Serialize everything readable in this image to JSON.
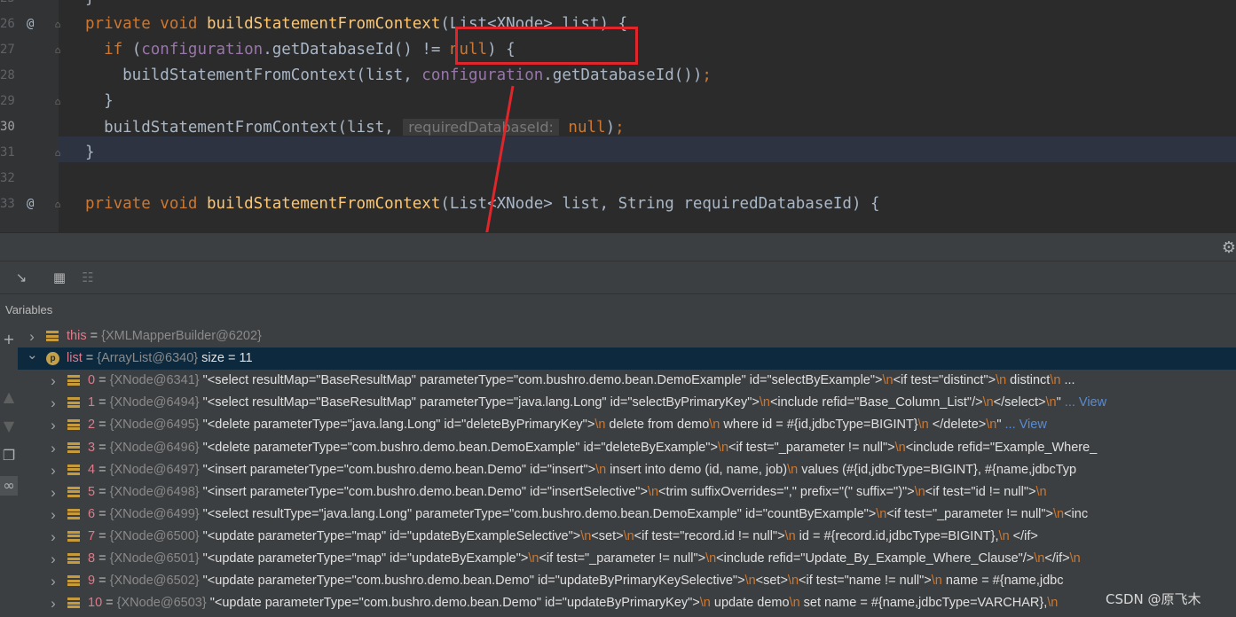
{
  "editor": {
    "lines": [
      {
        "num": "25",
        "code": [
          {
            "t": "}",
            "c": "pl"
          }
        ]
      },
      {
        "num": "26",
        "marker": "@",
        "code": [
          {
            "t": "private ",
            "c": "kw"
          },
          {
            "t": "void ",
            "c": "kw"
          },
          {
            "t": "buildStatementFromContext",
            "c": "fn"
          },
          {
            "t": "(List<XNode> list) {",
            "c": "pl"
          }
        ]
      },
      {
        "num": "27",
        "code": [
          {
            "t": "  if ",
            "c": "kw"
          },
          {
            "t": "(",
            "c": "pl"
          },
          {
            "t": "configuration",
            "c": "fld"
          },
          {
            "t": ".getDatabaseId() != ",
            "c": "pl"
          },
          {
            "t": "null",
            "c": "kw"
          },
          {
            "t": ") {",
            "c": "pl"
          }
        ]
      },
      {
        "num": "28",
        "code": [
          {
            "t": "    buildStatementFromContext(list, ",
            "c": "pl"
          },
          {
            "t": "configuration",
            "c": "fld"
          },
          {
            "t": ".getDatabaseId())",
            "c": "pl"
          },
          {
            "t": ";",
            "c": "kw"
          }
        ]
      },
      {
        "num": "29",
        "code": [
          {
            "t": "  }",
            "c": "pl"
          }
        ]
      },
      {
        "num": "30",
        "current": true,
        "code": [
          {
            "t": "  buildStatementFromContext(list, ",
            "c": "pl"
          },
          {
            "hint": "requiredDatabaseId:"
          },
          {
            "t": " null",
            "c": "kw"
          },
          {
            "t": ")",
            "c": "pl"
          },
          {
            "t": ";",
            "c": "kw"
          }
        ]
      },
      {
        "num": "31",
        "code": [
          {
            "t": "}",
            "c": "pl"
          }
        ]
      },
      {
        "num": "32",
        "code": []
      },
      {
        "num": "33",
        "marker": "@",
        "code": [
          {
            "t": "private ",
            "c": "kw"
          },
          {
            "t": "void ",
            "c": "kw"
          },
          {
            "t": "buildStatementFromContext",
            "c": "fn"
          },
          {
            "t": "(List<XNode> list, String requiredDatabaseId) {",
            "c": "pl"
          }
        ]
      }
    ]
  },
  "panel": {
    "variables_title": "Variables",
    "toolbar_icons": [
      "step-cursor-icon",
      "table-icon",
      "grid-off-icon"
    ]
  },
  "variables": [
    {
      "name": "this",
      "ref": "{XMLMapperBuilder@6202}",
      "value": "",
      "expand": "collapsed",
      "icon": "field",
      "indent": 0
    },
    {
      "name": "list",
      "ref": "{ArrayList@6340}",
      "value": "size = 11",
      "expand": "expanded",
      "icon": "p",
      "indent": 0,
      "selected": true
    },
    {
      "name": "0",
      "ref": "{XNode@6341}",
      "value": "\"<select resultMap=\"BaseResultMap\" parameterType=\"com.bushro.demo.bean.DemoExample\" id=\"selectByExample\">\\n<if test=\"distinct\">\\n      distinct\\n ...",
      "expand": "collapsed",
      "icon": "field",
      "indent": 1
    },
    {
      "name": "1",
      "ref": "{XNode@6494}",
      "value": "\"<select resultMap=\"BaseResultMap\" parameterType=\"java.lang.Long\" id=\"selectByPrimaryKey\">\\n<include refid=\"Base_Column_List\"/>\\n</select>\\n\" ... View",
      "expand": "collapsed",
      "icon": "field",
      "indent": 1
    },
    {
      "name": "2",
      "ref": "{XNode@6495}",
      "value": "\"<delete parameterType=\"java.lang.Long\" id=\"deleteByPrimaryKey\">\\n    delete from demo\\n    where id = #{id,jdbcType=BIGINT}\\n  </delete>\\n\" ... View",
      "expand": "collapsed",
      "icon": "field",
      "indent": 1
    },
    {
      "name": "3",
      "ref": "{XNode@6496}",
      "value": "\"<delete parameterType=\"com.bushro.demo.bean.DemoExample\" id=\"deleteByExample\">\\n<if test=\"_parameter != null\">\\n<include refid=\"Example_Where_",
      "expand": "collapsed",
      "icon": "field",
      "indent": 1
    },
    {
      "name": "4",
      "ref": "{XNode@6497}",
      "value": "\"<insert parameterType=\"com.bushro.demo.bean.Demo\" id=\"insert\">\\n    insert into demo (id, name, job)\\n    values (#{id,jdbcType=BIGINT}, #{name,jdbcTyp",
      "expand": "collapsed",
      "icon": "field",
      "indent": 1
    },
    {
      "name": "5",
      "ref": "{XNode@6498}",
      "value": "\"<insert parameterType=\"com.bushro.demo.bean.Demo\" id=\"insertSelective\">\\n<trim suffixOverrides=\",\" prefix=\"(\" suffix=\")\">\\n<if test=\"id != null\">\\n",
      "expand": "collapsed",
      "icon": "field",
      "indent": 1
    },
    {
      "name": "6",
      "ref": "{XNode@6499}",
      "value": "\"<select resultType=\"java.lang.Long\" parameterType=\"com.bushro.demo.bean.DemoExample\" id=\"countByExample\">\\n<if test=\"_parameter != null\">\\n<inc",
      "expand": "collapsed",
      "icon": "field",
      "indent": 1
    },
    {
      "name": "7",
      "ref": "{XNode@6500}",
      "value": "\"<update parameterType=\"map\" id=\"updateByExampleSelective\">\\n<set>\\n<if test=\"record.id != null\">\\n        id = #{record.id,jdbcType=BIGINT},\\n      </if>",
      "expand": "collapsed",
      "icon": "field",
      "indent": 1
    },
    {
      "name": "8",
      "ref": "{XNode@6501}",
      "value": "\"<update parameterType=\"map\" id=\"updateByExample\">\\n<if test=\"_parameter != null\">\\n<include refid=\"Update_By_Example_Where_Clause\"/>\\n</if>\\n",
      "expand": "collapsed",
      "icon": "field",
      "indent": 1
    },
    {
      "name": "9",
      "ref": "{XNode@6502}",
      "value": "\"<update parameterType=\"com.bushro.demo.bean.Demo\" id=\"updateByPrimaryKeySelective\">\\n<set>\\n<if test=\"name != null\">\\n        name = #{name,jdbc",
      "expand": "collapsed",
      "icon": "field",
      "indent": 1
    },
    {
      "name": "10",
      "ref": "{XNode@6503}",
      "value": "\"<update parameterType=\"com.bushro.demo.bean.Demo\" id=\"updateByPrimaryKey\">\\n    update demo\\n    set name = #{name,jdbcType=VARCHAR},\\n",
      "expand": "collapsed",
      "icon": "field",
      "indent": 1
    }
  ],
  "watermark": "CSDN @原飞木",
  "colors": {
    "annotation": "#e0262a",
    "keyword": "#cc7832",
    "method": "#ffc66d",
    "field": "#9876aa",
    "selection": "#0d293e"
  }
}
